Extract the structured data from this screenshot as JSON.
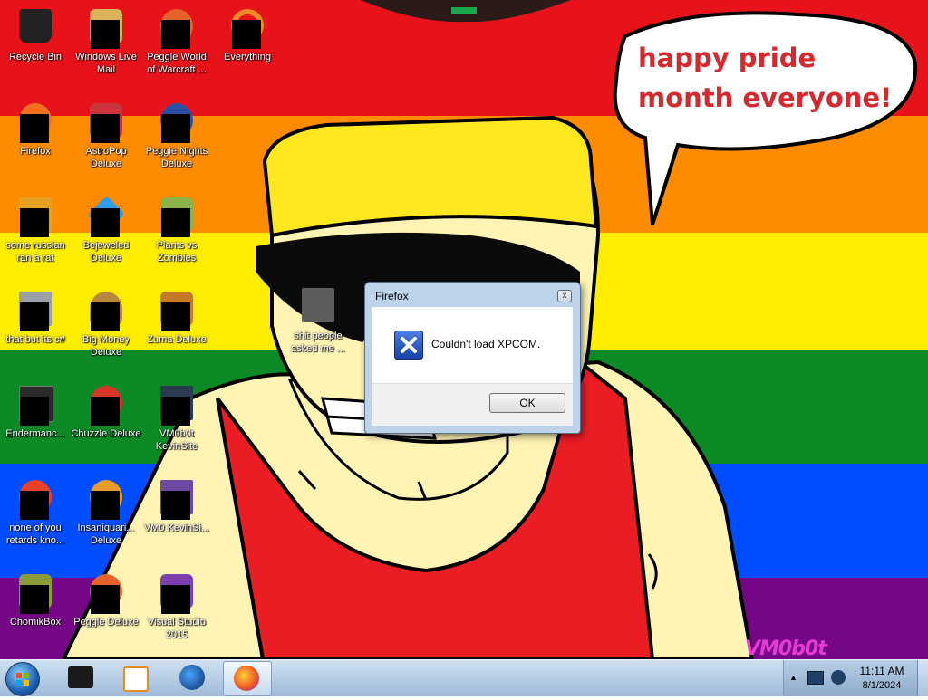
{
  "desktop": {
    "icons": [
      {
        "label": "Recycle Bin",
        "icon": "recycle-bin-icon",
        "color": "#222222"
      },
      {
        "label": "Windows Live Mail",
        "icon": "mail-icon",
        "color": "#d9b25b"
      },
      {
        "label": "Peggle World of Warcraft ...",
        "icon": "peggle-icon",
        "color": "#e5632b"
      },
      {
        "label": "Everything",
        "icon": "search-icon",
        "color": "#f08a24"
      },
      {
        "label": "Firefox",
        "icon": "firefox-icon",
        "color": "#f07024"
      },
      {
        "label": "AstroPop Deluxe",
        "icon": "astropop-icon",
        "color": "#c8343a"
      },
      {
        "label": "Peggle Nights Deluxe",
        "icon": "peggle-nights-icon",
        "color": "#2b4fa3"
      },
      {
        "label": "some russian ran a rat",
        "icon": "file-icon",
        "color": "#e6a122"
      },
      {
        "label": "Bejeweled Deluxe",
        "icon": "gem-icon",
        "color": "#2f9cf0"
      },
      {
        "label": "Plants vs Zombies",
        "icon": "plant-icon",
        "color": "#8ab34a"
      },
      {
        "label": "that but its c#",
        "icon": "copy-icon",
        "color": "#9aa0a6"
      },
      {
        "label": "Big Money Deluxe",
        "icon": "money-icon",
        "color": "#b7883d"
      },
      {
        "label": "Zuma Deluxe",
        "icon": "zuma-icon",
        "color": "#c47a28"
      },
      {
        "label": "Endermanc...",
        "icon": "terminal-icon",
        "color": "#2a2a2a"
      },
      {
        "label": "Chuzzle Deluxe",
        "icon": "chuzzle-icon",
        "color": "#d8352a"
      },
      {
        "label": "VM0b0t KevinSite",
        "icon": "vm-icon",
        "color": "#2a3b52"
      },
      {
        "label": "none of you retards kno...",
        "icon": "firefox-icon",
        "color": "#e5412b"
      },
      {
        "label": "Insaniquari... Deluxe",
        "icon": "fish-icon",
        "color": "#e89a2c"
      },
      {
        "label": "VM0 KevinSi...",
        "icon": "file-icon",
        "color": "#6b4aa0"
      },
      {
        "label": "ChomikBox",
        "icon": "chomikbox-icon",
        "color": "#8a9c3a"
      },
      {
        "label": "Peggle Deluxe",
        "icon": "peggle-icon",
        "color": "#e5632b"
      },
      {
        "label": "Visual Studio 2015",
        "icon": "visual-studio-icon",
        "color": "#7b3fb0"
      },
      {
        "label": "shit people asked me ...",
        "icon": "folder-icon",
        "color": "#5d5d5d"
      }
    ],
    "bubble_text": "happy pride month everyone!",
    "watermark": "VM0b0t",
    "pride_colors": [
      "#e40303",
      "#ff8c00",
      "#ffed00",
      "#008026",
      "#004dff",
      "#750787"
    ]
  },
  "dialog": {
    "title": "Firefox",
    "close_glyph": "x",
    "message": "Couldn't load XPCOM.",
    "ok_label": "OK"
  },
  "taskbar": {
    "items": [
      {
        "name": "start-button",
        "icon": "windows-logo-icon"
      },
      {
        "name": "taskbar-terminal",
        "icon": "terminal-icon"
      },
      {
        "name": "taskbar-media-player",
        "icon": "media-player-icon"
      },
      {
        "name": "taskbar-browser",
        "icon": "globe-icon"
      },
      {
        "name": "taskbar-firefox",
        "icon": "firefox-icon",
        "active": true
      }
    ],
    "time": "11:11 AM",
    "date": "8/1/2024"
  }
}
